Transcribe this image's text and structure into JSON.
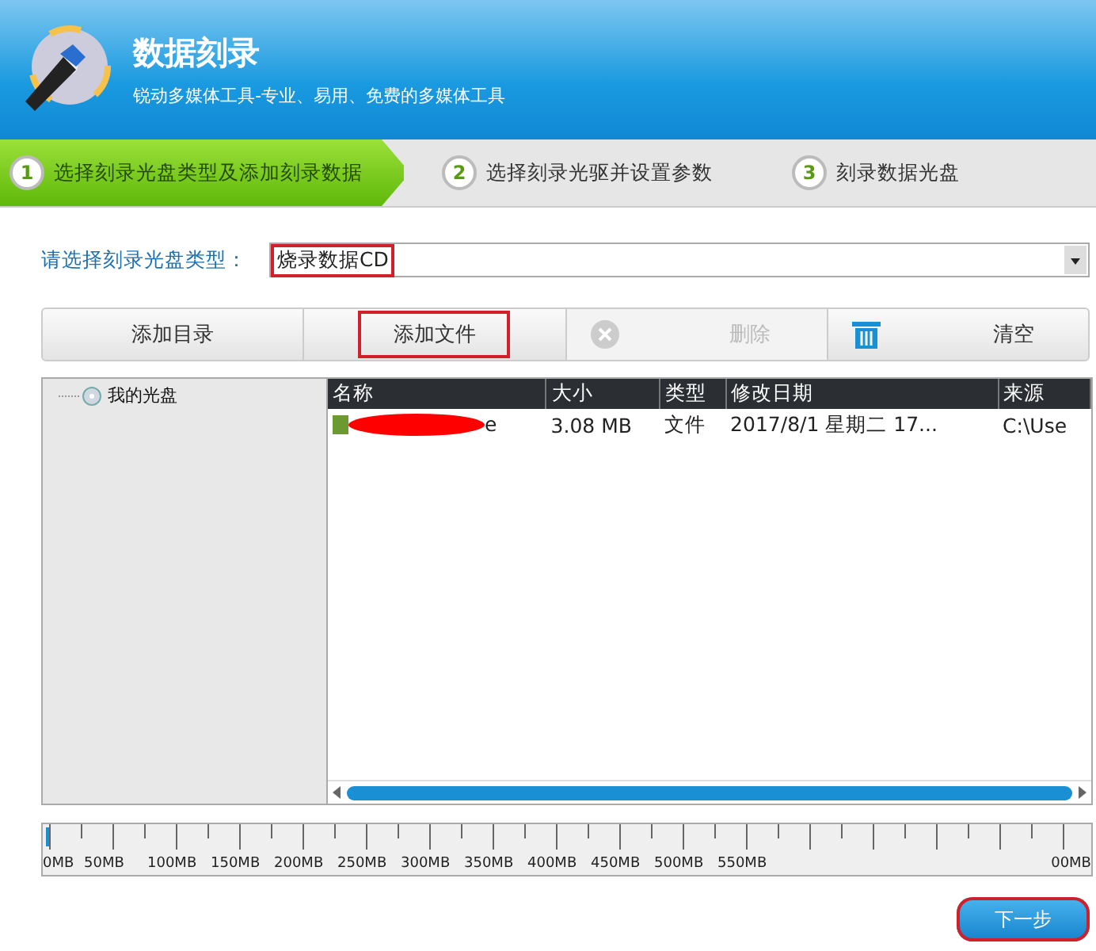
{
  "header": {
    "title": "数据刻录",
    "subtitle": "锐动多媒体工具-专业、易用、免费的多媒体工具"
  },
  "steps": [
    {
      "number": "1",
      "label": "选择刻录光盘类型及添加刻录数据",
      "selected": true
    },
    {
      "number": "2",
      "label": "选择刻录光驱并设置参数",
      "selected": false
    },
    {
      "number": "3",
      "label": "刻录数据光盘",
      "selected": false
    }
  ],
  "disc_type": {
    "label": "请选择刻录光盘类型：",
    "value": "烧录数据CD",
    "highlighted": true
  },
  "toolbar": [
    {
      "label": "添加目录",
      "disabled": false,
      "highlighted": false,
      "kind": "plain"
    },
    {
      "label": "添加文件",
      "disabled": false,
      "highlighted": true,
      "kind": "plain"
    },
    {
      "label": "删除",
      "disabled": true,
      "highlighted": false,
      "kind": "delete"
    },
    {
      "label": "清空",
      "disabled": false,
      "highlighted": false,
      "kind": "trash"
    }
  ],
  "tree": [
    {
      "label": "我的光盘"
    }
  ],
  "table": {
    "columns": [
      "名称",
      "大小",
      "类型",
      "修改日期",
      "来源"
    ],
    "rows": [
      {
        "name": "e",
        "redacted": true,
        "size": "3.08 MB",
        "type": "文件",
        "modified": "2017/8/1 星期二 17...",
        "source": "C:\\Use"
      }
    ]
  },
  "ruler": {
    "labels": [
      {
        "text": "0MB",
        "kind": "tick"
      },
      {
        "text": "50MB",
        "kind": "tick"
      },
      {
        "text": "100MB",
        "kind": "tick"
      },
      {
        "text": "150MB",
        "kind": "tick"
      },
      {
        "text": "200MB",
        "kind": "tick"
      },
      {
        "text": "250MB",
        "kind": "tick"
      },
      {
        "text": "300MB",
        "kind": "tick"
      },
      {
        "text": "350MB",
        "kind": "tick"
      },
      {
        "text": "400MB",
        "kind": "tick"
      },
      {
        "text": "450MB",
        "kind": "tick"
      },
      {
        "text": "500MB",
        "kind": "tick"
      },
      {
        "text": "550MB",
        "kind": "tick"
      },
      {
        "text": "00MB",
        "kind": "edge"
      }
    ],
    "level": 0.003
  },
  "next_button": {
    "label": "下一步",
    "highlighted": true
  }
}
